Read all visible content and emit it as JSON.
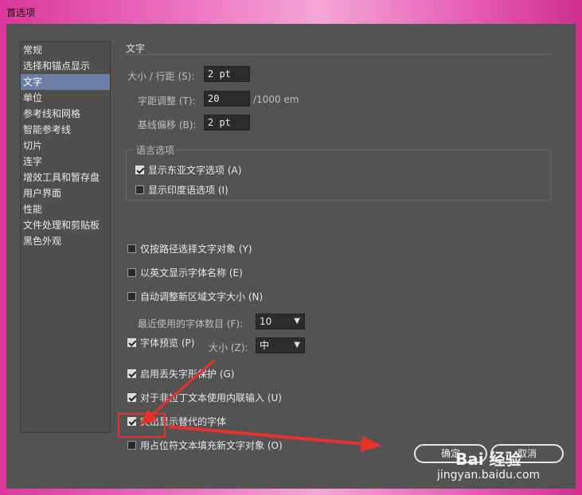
{
  "window": {
    "title": "首选项"
  },
  "sidebar": {
    "items": [
      {
        "label": "常规"
      },
      {
        "label": "选择和锚点显示"
      },
      {
        "label": "文字",
        "active": true
      },
      {
        "label": "单位"
      },
      {
        "label": "参考线和网格"
      },
      {
        "label": "智能参考线"
      },
      {
        "label": "切片"
      },
      {
        "label": "连字"
      },
      {
        "label": "增效工具和暂存盘"
      },
      {
        "label": "用户界面"
      },
      {
        "label": "性能"
      },
      {
        "label": "文件处理和剪贴板"
      },
      {
        "label": "黑色外观"
      }
    ]
  },
  "type_section": {
    "title": "文字",
    "size_leading": {
      "label": "大小 / 行距 (S):",
      "value": "2 pt"
    },
    "tracking": {
      "label": "字距调整 (T):",
      "value": "20",
      "unit": "/1000 em"
    },
    "baseline_shift": {
      "label": "基线偏移 (B):",
      "value": "2 pt"
    },
    "language_group": {
      "title": "语言选项",
      "show_east_asian": {
        "label": "显示东亚文字选项 (A)",
        "checked": true
      },
      "show_indic": {
        "label": "显示印度语选项 (I)",
        "checked": false
      }
    },
    "type_object_selection_by_path": {
      "label": "仅按路径选择文字对象 (Y)",
      "checked": false
    },
    "show_font_names_english": {
      "label": "以英文显示字体名称 (E)",
      "checked": false
    },
    "auto_size_area_type": {
      "label": "自动调整新区域文字大小 (N)",
      "checked": false
    },
    "recent_fonts": {
      "label": "最近使用的字体数目 (F):",
      "value": "10"
    },
    "font_preview": {
      "label": "字体预览 (P)",
      "checked": true,
      "size_label": "大小 (Z):",
      "size_value": "中"
    },
    "missing_glyph_protection": {
      "label": "启用丢失字形保护 (G)",
      "checked": true
    },
    "inline_input_non_latin": {
      "label": "对于非拉丁文本使用内联输入 (U)",
      "checked": true
    },
    "highlight_substituted_fonts": {
      "label": "突出显示替代的字体",
      "checked": true
    },
    "fill_placeholder_text": {
      "label": "用占位符文本填充新文字对象 (O)",
      "checked": false
    }
  },
  "buttons": {
    "ok": "确定",
    "cancel": "取消"
  },
  "watermark": {
    "brand": "Bai 经验",
    "url": "jingyan.baidu.com"
  },
  "colors": {
    "annotation_red": "#e8312b",
    "active_item": "#6a7ea6"
  }
}
